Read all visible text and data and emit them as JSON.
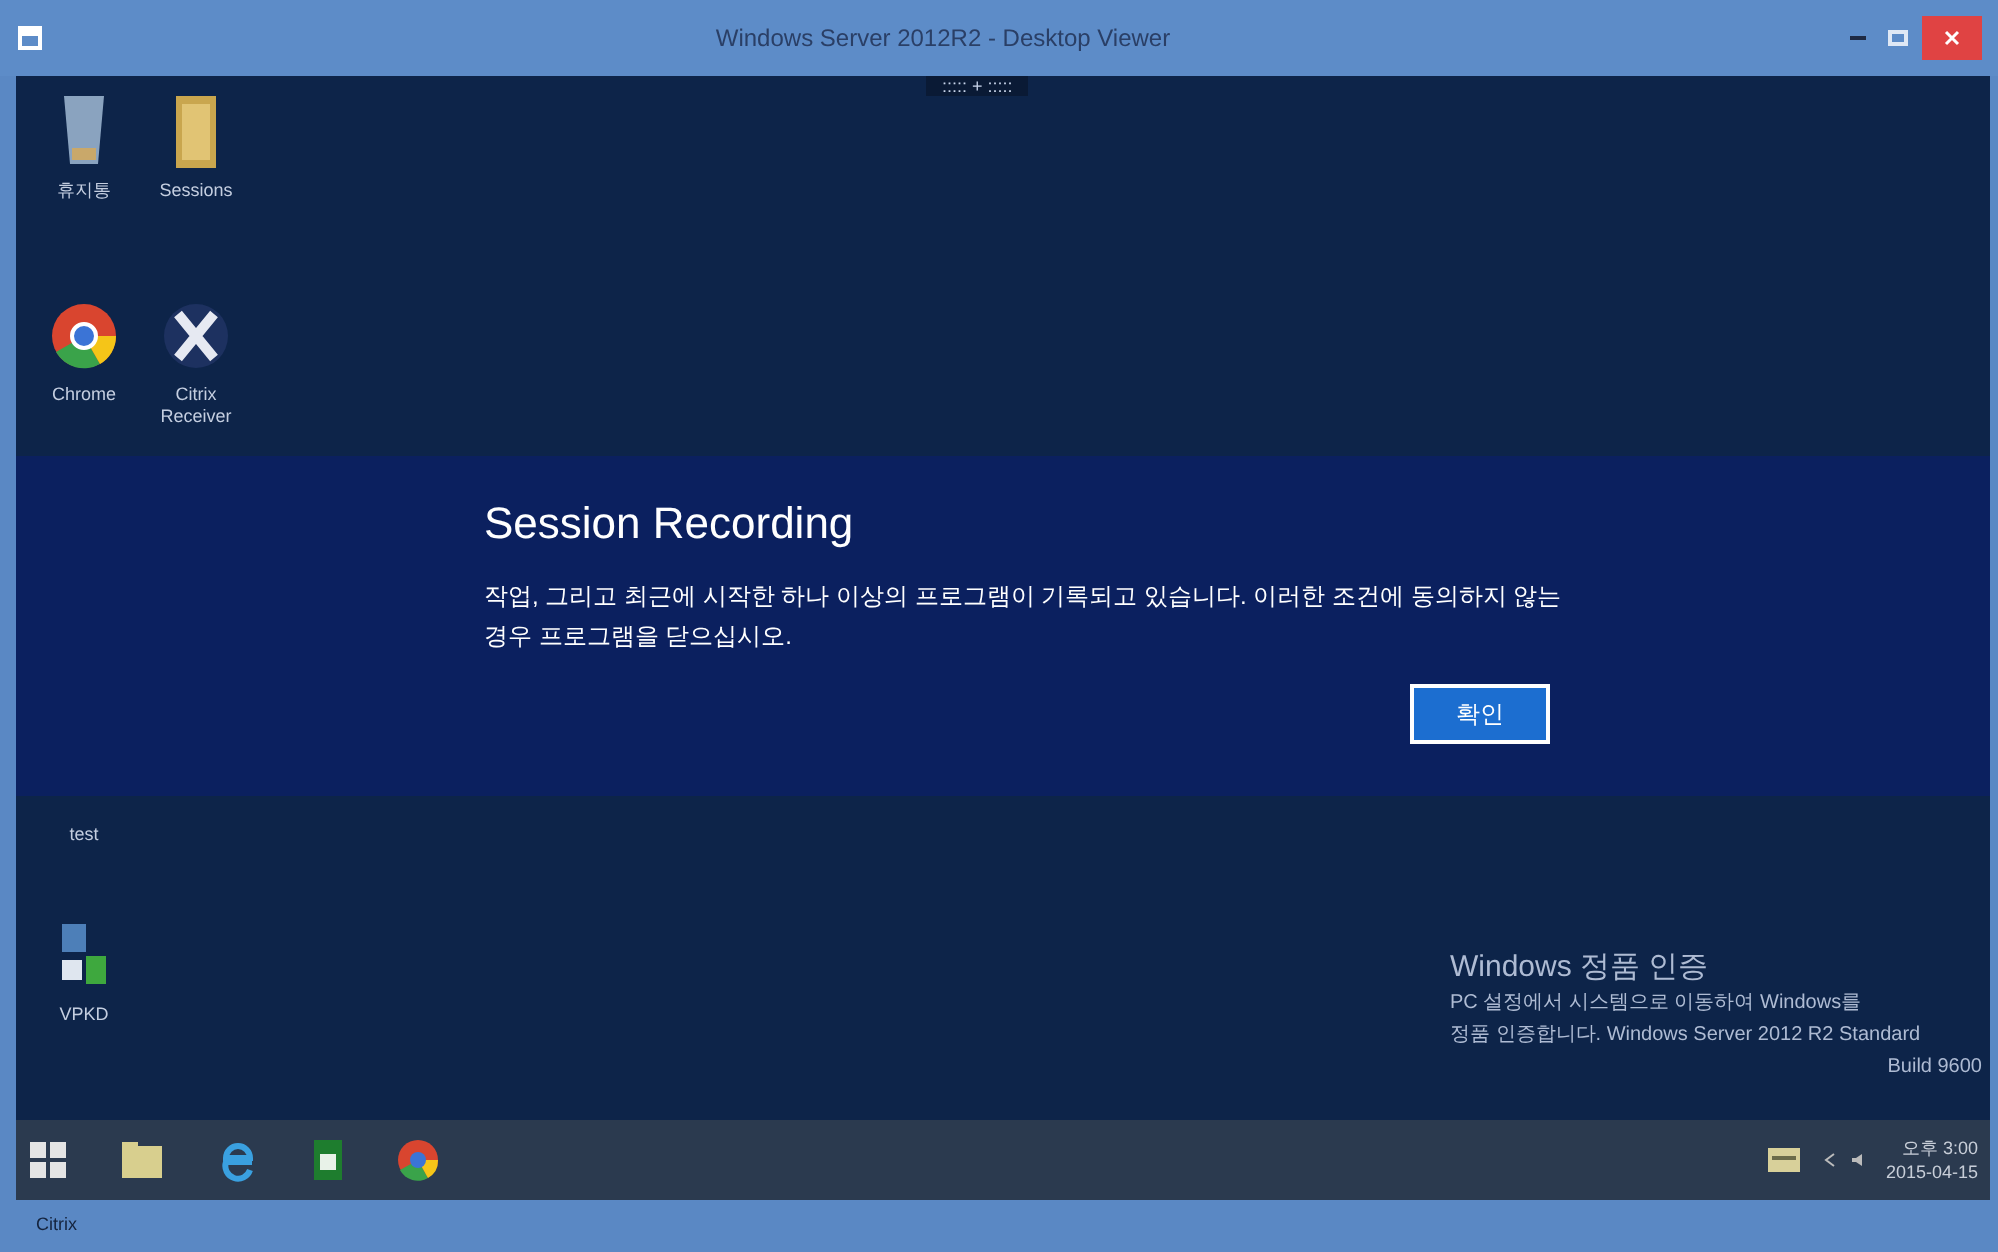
{
  "window": {
    "title": "Windows Server 2012R2 - Desktop Viewer"
  },
  "toolbar_handle": {
    "label": "::::: + :::::"
  },
  "desktop_icons": [
    {
      "label": "휴지통",
      "kind": "bin"
    },
    {
      "label": "Sessions",
      "kind": "folder"
    },
    {
      "label": "Chrome",
      "kind": "chrome"
    },
    {
      "label": "Citrix Receiver",
      "kind": "citrix"
    },
    {
      "label": "test",
      "kind": "blank"
    },
    {
      "label": "VPKD",
      "kind": "network"
    }
  ],
  "dialog": {
    "title": "Session Recording",
    "message": "작업, 그리고 최근에 시작한 하나 이상의 프로그램이 기록되고 있습니다. 이러한 조건에 동의하지 않는 경우 프로그램을 닫으십시오.",
    "button": "확인"
  },
  "activation_notice": {
    "title": "Windows 정품 인증",
    "lines": [
      "PC 설정에서 시스템으로 이동하여 Windows를",
      "정품 인증합니다. Windows Server 2012 R2 Standard",
      "Build 9600"
    ]
  },
  "taskbar": {
    "apps": [
      {
        "kind": "start"
      },
      {
        "kind": "explorer"
      },
      {
        "kind": "ie"
      },
      {
        "kind": "server-manager"
      },
      {
        "kind": "chrome"
      }
    ],
    "clock": {
      "time": "오후 3:00",
      "date": "2015-04-15"
    }
  },
  "status_bar": {
    "text": "Citrix"
  }
}
